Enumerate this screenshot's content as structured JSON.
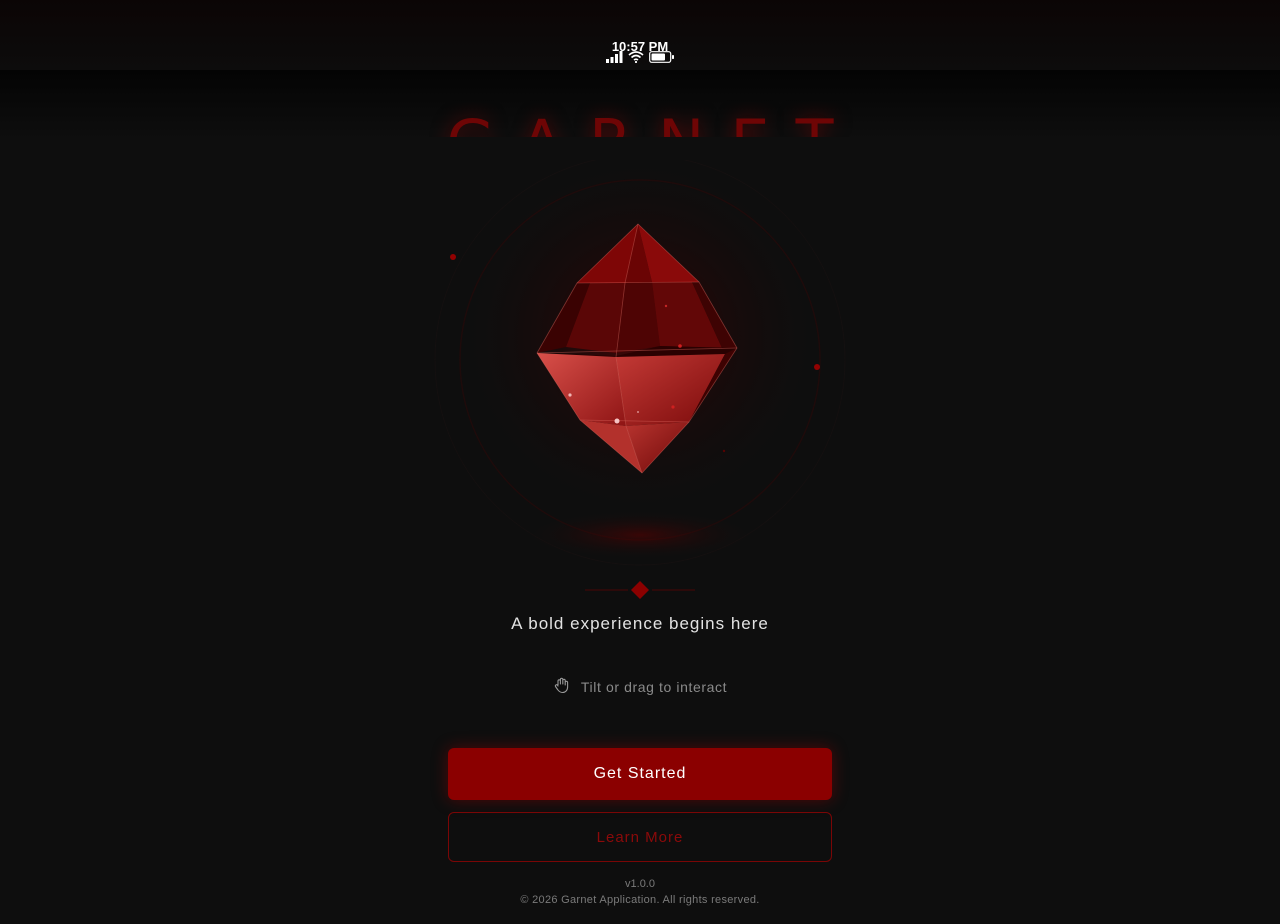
{
  "status_bar": {
    "time": "10:57 PM",
    "icons": [
      "signal-icon",
      "wifi-icon",
      "battery-icon"
    ]
  },
  "brand": {
    "title": "GARNET"
  },
  "hero": {
    "tagline": "A bold experience begins here",
    "hint_icon": "hand-icon",
    "hint": "Tilt or drag to interact"
  },
  "actions": {
    "primary_label": "Get Started",
    "secondary_label": "Learn More"
  },
  "footer": {
    "version": "v1.0.0",
    "copyright": "© 2026 Garnet Application. All rights reserved."
  },
  "colors": {
    "background": "#0e0e0e",
    "accent": "#8b0000",
    "accent_text": "#8b0a0a"
  }
}
